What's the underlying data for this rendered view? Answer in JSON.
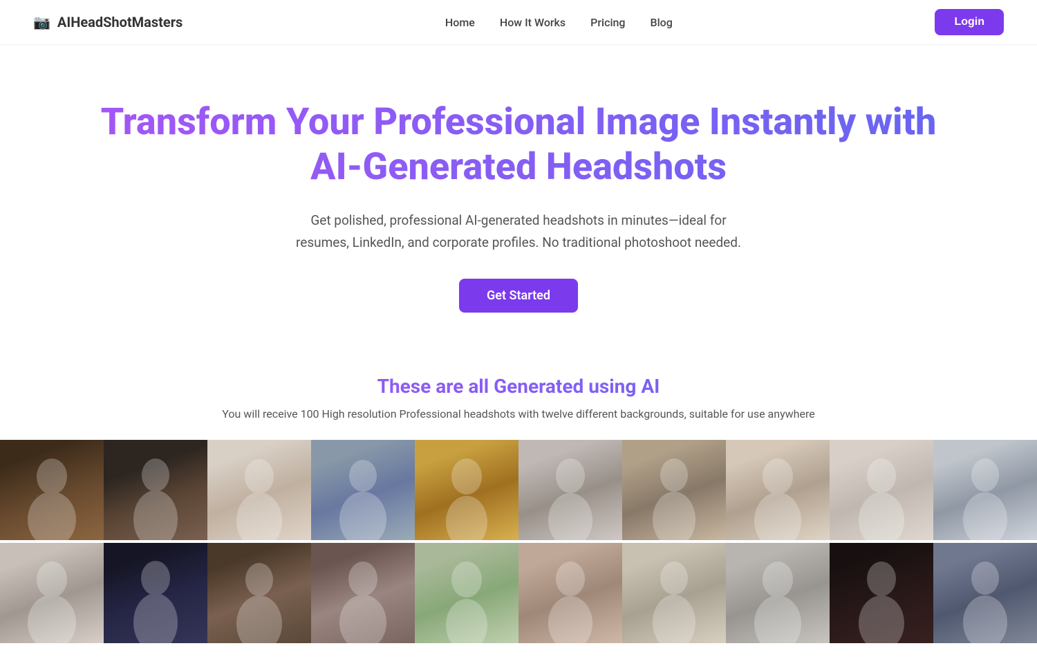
{
  "brand": {
    "name": "AIHeadShotMasters",
    "icon": "📷"
  },
  "nav": {
    "links": [
      {
        "id": "home",
        "label": "Home"
      },
      {
        "id": "how-it-works",
        "label": "How It Works"
      },
      {
        "id": "pricing",
        "label": "Pricing"
      },
      {
        "id": "blog",
        "label": "Blog"
      }
    ],
    "login_label": "Login"
  },
  "hero": {
    "title_line1": "Transform Your Professional Image Instantly with",
    "title_line2": "AI-Generated Headshots",
    "subtitle": "Get polished, professional AI-generated headshots in minutes—ideal for resumes, LinkedIn, and corporate profiles. No traditional photoshoot needed.",
    "cta_label": "Get Started"
  },
  "gallery": {
    "section_title": "These are all Generated using AI",
    "section_subtitle": "You will receive 100 High resolution Professional headshots with twelve different backgrounds, suitable for use anywhere",
    "rows": [
      {
        "id": "row1",
        "cells": [
          {
            "id": "p1",
            "css_class": "p1"
          },
          {
            "id": "p2",
            "css_class": "p2"
          },
          {
            "id": "p3",
            "css_class": "p3"
          },
          {
            "id": "p4",
            "css_class": "p4"
          },
          {
            "id": "p5",
            "css_class": "p5"
          },
          {
            "id": "p6",
            "css_class": "p6"
          },
          {
            "id": "p7",
            "css_class": "p7"
          },
          {
            "id": "p8",
            "css_class": "p8"
          },
          {
            "id": "p9",
            "css_class": "p9"
          },
          {
            "id": "p10",
            "css_class": "p10"
          }
        ]
      },
      {
        "id": "row2",
        "cells": [
          {
            "id": "p11",
            "css_class": "p11"
          },
          {
            "id": "p12",
            "css_class": "p12"
          },
          {
            "id": "p13",
            "css_class": "p13"
          },
          {
            "id": "p14",
            "css_class": "p14"
          },
          {
            "id": "p15",
            "css_class": "p15"
          },
          {
            "id": "p16",
            "css_class": "p16"
          },
          {
            "id": "p17",
            "css_class": "p17"
          },
          {
            "id": "p18",
            "css_class": "p18"
          },
          {
            "id": "p19",
            "css_class": "p19"
          },
          {
            "id": "p20",
            "css_class": "p20"
          }
        ]
      }
    ]
  }
}
